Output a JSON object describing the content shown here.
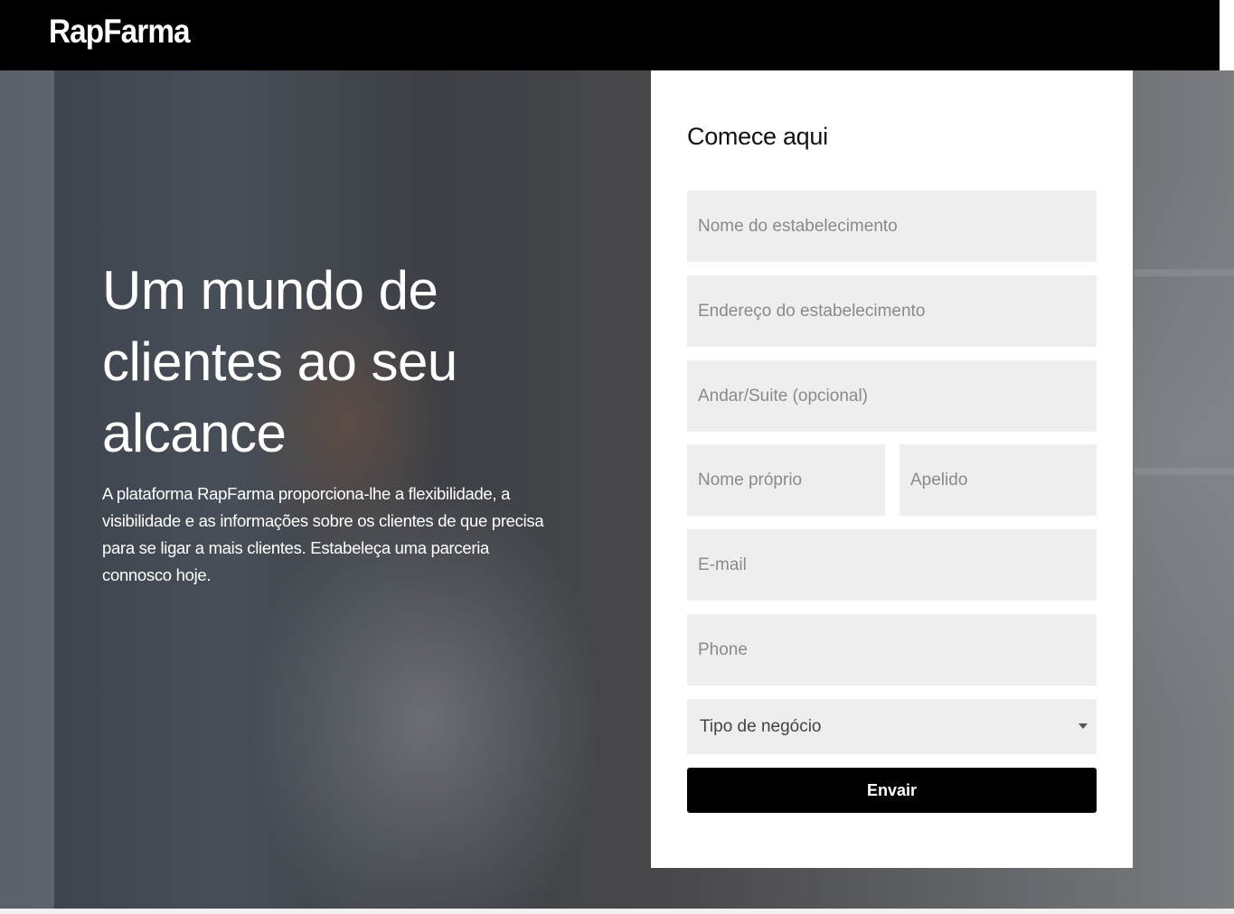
{
  "header": {
    "logo": "RapFarma"
  },
  "hero": {
    "headline": "Um mundo de clientes ao seu alcance",
    "description": "A plataforma RapFarma proporciona-lhe a flexibilidade, a visibilidade e as informações sobre os clientes de que precisa para se ligar a mais clientes. Estabeleça uma parceria connosco hoje."
  },
  "form": {
    "title": "Comece aqui",
    "establishment_name_placeholder": "Nome do estabelecimento",
    "establishment_address_placeholder": "Endereço do estabelecimento",
    "floor_suite_placeholder": "Andar/Suite (opcional)",
    "first_name_placeholder": "Nome próprio",
    "last_name_placeholder": "Apelido",
    "email_placeholder": "E-mail",
    "phone_placeholder": "Phone",
    "business_type_selected": "Tipo de negócio",
    "submit_label": "Envair"
  },
  "colors": {
    "header_bg": "#000000",
    "field_bg": "#eeeeee",
    "button_bg": "#000000",
    "card_bg": "#ffffff"
  },
  "icons": {
    "select_arrow": "caret-down-icon"
  }
}
